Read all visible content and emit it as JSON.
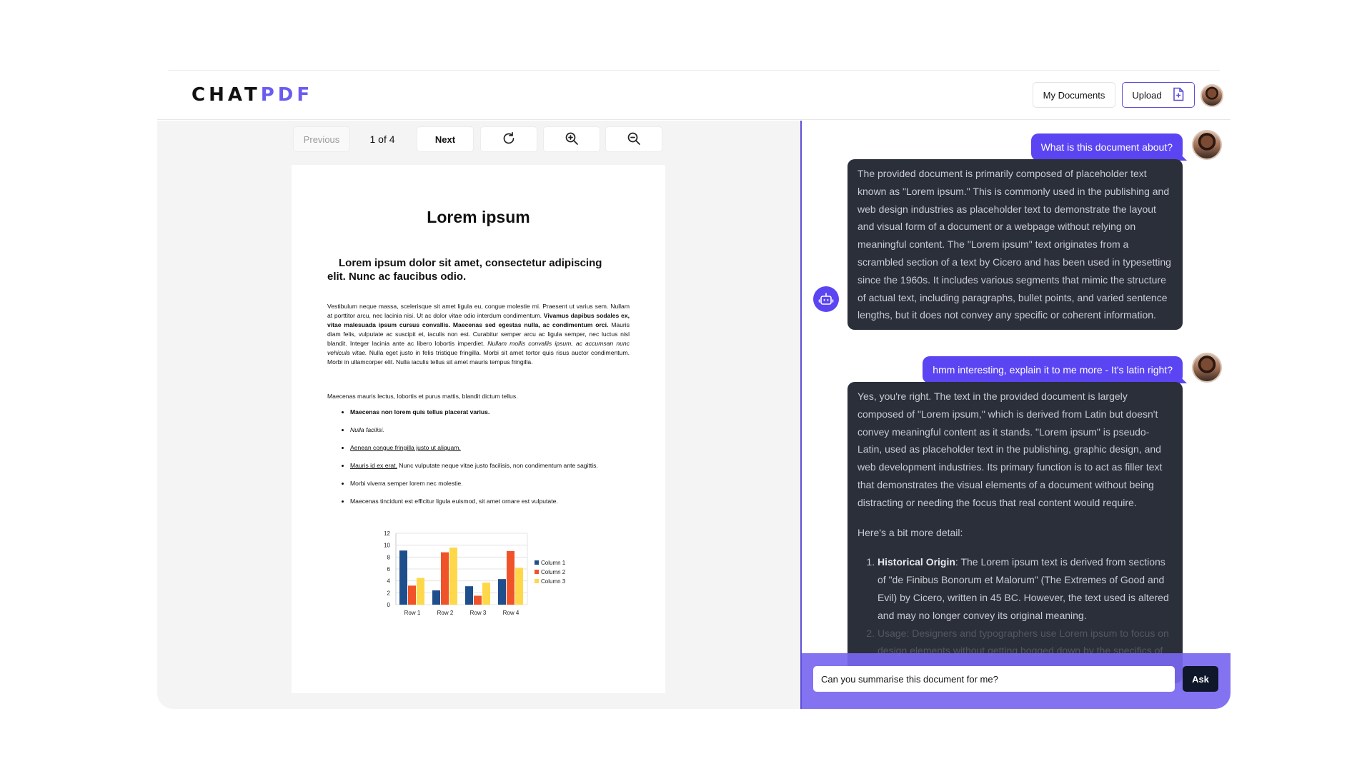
{
  "app": {
    "logo_main": "CHAT",
    "logo_accent": "PDF"
  },
  "header": {
    "my_documents_label": "My Documents",
    "upload_label": "Upload"
  },
  "viewer": {
    "previous_label": "Previous",
    "page_indicator": "1 of 4",
    "next_label": "Next",
    "refresh_icon": "refresh-icon",
    "zoom_in_icon": "zoom-in-icon",
    "zoom_out_icon": "zoom-out-icon"
  },
  "document": {
    "title": "Lorem ipsum",
    "subtitle": "Lorem ipsum dolor sit amet, consectetur adipiscing elit. Nunc ac faucibus odio.",
    "para1": {
      "t1": "Vestibulum neque massa, scelerisque sit amet ligula eu, congue molestie mi. Praesent ut varius sem. Nullam at porttitor arcu, nec lacinia nisi. Ut ac dolor vitae odio interdum condimentum. ",
      "t2": "Vivamus dapibus sodales ex, vitae malesuada ipsum cursus convallis. Maecenas sed egestas nulla, ac condimentum orci.",
      "t3": " Mauris diam felis, vulputate ac suscipit et, iaculis non est. Curabitur semper arcu ac ligula semper, nec luctus nisl blandit. Integer lacinia ante ac libero lobortis imperdiet. ",
      "t4": "Nullam mollis convallis ipsum, ac accumsan nunc vehicula vitae.",
      "t5": " Nulla eget justo in felis tristique fringilla. Morbi sit amet tortor quis risus auctor condimentum. Morbi in ullamcorper elit. Nulla iaculis tellus sit amet mauris tempus fringilla."
    },
    "para2": "Maecenas mauris lectus, lobortis et purus mattis, blandit dictum tellus.",
    "list": {
      "item1": "Maecenas non lorem quis tellus placerat varius.",
      "item2": "Nulla facilisi.",
      "item3": "Aenean congue fringilla justo ut aliquam.",
      "item4_link": "Mauris id ex erat.",
      "item4_rest": " Nunc vulputate neque vitae justo facilisis, non condimentum ante sagittis.",
      "item5": "Morbi viverra semper lorem nec molestie.",
      "item6": "Maecenas tincidunt est efficitur ligula euismod, sit amet ornare est vulputate."
    }
  },
  "chart_data": {
    "type": "bar",
    "categories": [
      "Row 1",
      "Row 2",
      "Row 3",
      "Row 4"
    ],
    "series": [
      {
        "name": "Column 1",
        "values": [
          9.1,
          2.4,
          3.1,
          4.3
        ],
        "color": "#1f4e8c"
      },
      {
        "name": "Column 2",
        "values": [
          3.2,
          8.8,
          1.5,
          9.0
        ],
        "color": "#f0522a"
      },
      {
        "name": "Column 3",
        "values": [
          4.5,
          9.6,
          3.7,
          6.2
        ],
        "color": "#ffd84a"
      }
    ],
    "yticks": [
      "0",
      "2",
      "4",
      "6",
      "8",
      "10",
      "12"
    ],
    "ylim": [
      0,
      12
    ],
    "grid": true,
    "legend_position": "right"
  },
  "chat": {
    "q1": "What is this document about?",
    "a1": "The provided document is primarily composed of placeholder text known as \"Lorem ipsum.\" This is commonly used in the publishing and web design industries as placeholder text to demonstrate the layout and visual form of a document or a webpage without relying on meaningful content. The \"Lorem ipsum\" text originates from a scrambled section of a text by Cicero and has been used in typesetting since the 1960s. It includes various segments that mimic the structure of actual text, including paragraphs, bullet points, and varied sentence lengths, but it does not convey any specific or coherent information.",
    "q2": "hmm interesting, explain it to me more - It's latin right?",
    "a2_p1": "Yes, you're right. The text in the provided document is largely composed of \"Lorem ipsum,\" which is derived from Latin but doesn't convey meaningful content as it stands. \"Lorem ipsum\" is pseudo-Latin, used as placeholder text in the publishing, graphic design, and web development industries. Its primary function is to act as filler text that demonstrates the visual elements of a document without being distracting or needing the focus that real content would require.",
    "a2_p2": "Here's a bit more detail:",
    "a2_li1_title": "Historical Origin",
    "a2_li1_body": ": The Lorem ipsum text is derived from sections of \"de Finibus Bonorum et Malorum\" (The Extremes of Good and Evil) by Cicero, written in 45 BC. However, the text used is altered and may no longer convey its original meaning.",
    "a2_li2": "Usage: Designers and typographers use Lorem ipsum to focus on design elements without getting bogged down by the specifics of content. It helps clients to",
    "input_value": "Can you summarise this document for me?",
    "ask_label": "Ask"
  }
}
